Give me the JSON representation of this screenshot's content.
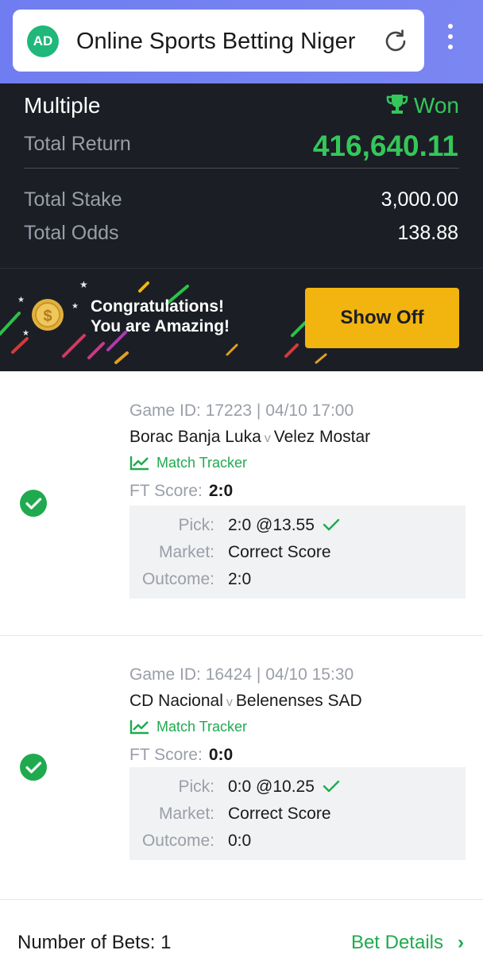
{
  "browser": {
    "badge": "AD",
    "title": "Online Sports Betting Niger"
  },
  "summary": {
    "type": "Multiple",
    "status": "Won",
    "total_return_label": "Total Return",
    "total_return": "416,640.11",
    "total_stake_label": "Total Stake",
    "total_stake": "3,000.00",
    "total_odds_label": "Total Odds",
    "total_odds": "138.88",
    "status_color": "#34c759"
  },
  "banner": {
    "line1": "Congratulations!",
    "line2": "You are Amazing!",
    "button": "Show Off",
    "button_color": "#f2b40f"
  },
  "bets": [
    {
      "game_id": "Game ID: 17223 | 04/10 17:00",
      "home": "Borac Banja Luka",
      "vs": "v",
      "away": "Velez Mostar",
      "tracker": "Match Tracker",
      "ft_label": "FT Score:",
      "ft_score": "2:0",
      "pick_label": "Pick:",
      "pick": "2:0 @13.55",
      "market_label": "Market:",
      "market": "Correct Score",
      "outcome_label": "Outcome:",
      "outcome": "2:0"
    },
    {
      "game_id": "Game ID: 16424 | 04/10 15:30",
      "home": "CD Nacional",
      "vs": "v",
      "away": "Belenenses SAD",
      "tracker": "Match Tracker",
      "ft_label": "FT Score:",
      "ft_score": "0:0",
      "pick_label": "Pick:",
      "pick": "0:0 @10.25",
      "market_label": "Market:",
      "market": "Correct Score",
      "outcome_label": "Outcome:",
      "outcome": "0:0"
    }
  ],
  "footer": {
    "bets_count": "Number of Bets: 1",
    "details": "Bet Details",
    "chevron": "›"
  }
}
